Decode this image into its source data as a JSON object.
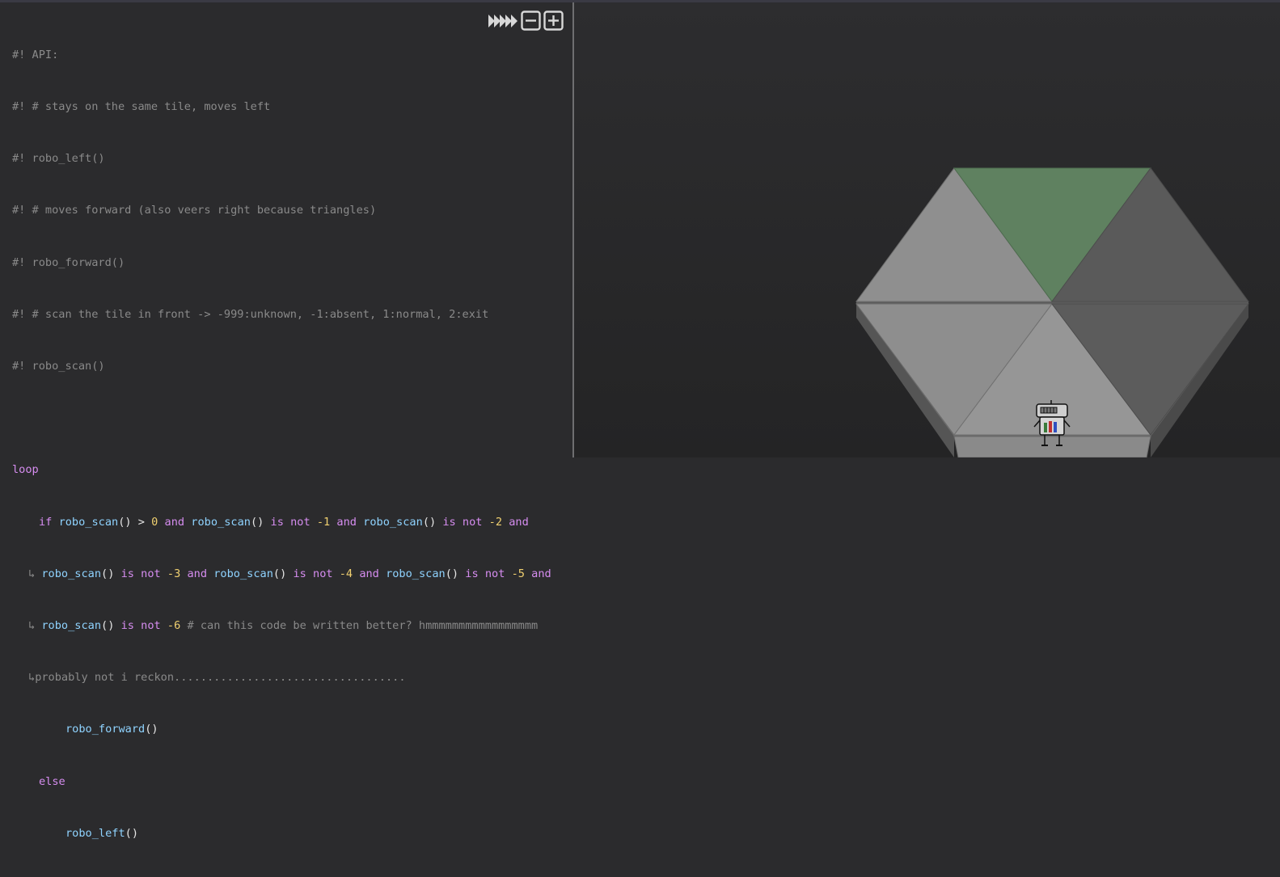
{
  "editor": {
    "lines": [
      {
        "kind": "comment",
        "text": "#! API:"
      },
      {
        "kind": "comment",
        "text": "#! # stays on the same tile, moves left"
      },
      {
        "kind": "comment",
        "text": "#! robo_left()"
      },
      {
        "kind": "comment",
        "text": "#! # moves forward (also veers right because triangles)"
      },
      {
        "kind": "comment",
        "text": "#! robo_forward()"
      },
      {
        "kind": "comment",
        "text": "#! # scan the tile in front -> -999:unknown, -1:absent, 1:normal, 2:exit"
      },
      {
        "kind": "comment",
        "text": "#! robo_scan()"
      }
    ],
    "loop_kw": "loop",
    "if_kw": "if",
    "fn_scan": "robo_scan",
    "parens": "()",
    "gt": ">",
    "and_kw": "and",
    "isnot_kw": "is not",
    "n0": "0",
    "n1": "-1",
    "n2": "-2",
    "n3": "-3",
    "n4": "-4",
    "n5": "-5",
    "n6": "-6",
    "cont_marker": "↳",
    "inline_comment": "# can this code be written better? hmmmmmmmmmmmmmmmmm",
    "cont_comment": "probably not i reckon...................................",
    "fn_forward": "robo_forward",
    "else_kw": "else",
    "fn_left": "robo_left"
  },
  "toolbar": {
    "run_icon": "fast-forward-icon",
    "zoom_out_icon": "minus-box-icon",
    "zoom_in_icon": "plus-box-icon"
  },
  "scene": {
    "tile_exit_color": "#5f8160",
    "tile_normal_color": "#8e8e8e",
    "tile_dark_color": "#5a5a5a"
  }
}
